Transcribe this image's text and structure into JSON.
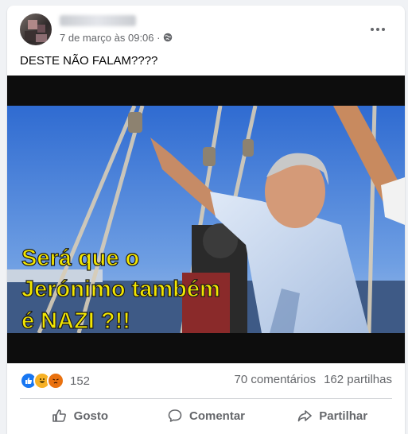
{
  "post": {
    "timestamp": "7 de março às 09:06 ·",
    "text": "DESTE NÃO FALAM????",
    "image_caption": [
      "Será que o",
      "Jerónimo também",
      "é NAZI ?!!"
    ]
  },
  "reactions": {
    "count": "152",
    "icons": [
      "like-icon",
      "haha-icon",
      "angry-icon"
    ]
  },
  "stats": {
    "comments": "70 comentários",
    "shares": "162 partilhas"
  },
  "actions": {
    "like": "Gosto",
    "comment": "Comentar",
    "share": "Partilhar"
  },
  "colors": {
    "accent": "#1877f2",
    "caption_fill": "#f2e600",
    "muted_text": "#65676b"
  }
}
